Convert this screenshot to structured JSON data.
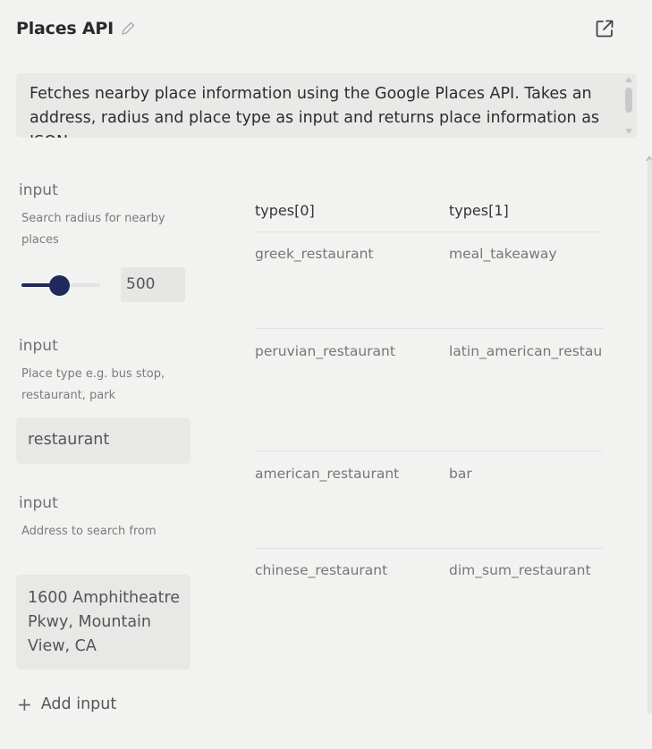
{
  "header": {
    "title": "Places API",
    "edit_icon": "pencil-icon",
    "open_icon": "external-link-icon"
  },
  "description": "Fetches nearby place information using the Google Places API. Takes an address, radius and place type as input and returns place information as JSON",
  "inputs": [
    {
      "label": "input",
      "hint": "Search radius for nearby places",
      "slider_value": 500,
      "slider_fraction": 0.49,
      "value": "500"
    },
    {
      "label": "input",
      "hint": "Place type e.g. bus stop, restaurant, park",
      "value": "restaurant"
    },
    {
      "label": "input",
      "hint": "Address to search from",
      "value": "1600 Amphitheatre Pkwy, Mountain View, CA"
    }
  ],
  "add_input_label": "Add input",
  "table": {
    "columns": [
      "types[0]",
      "types[1]"
    ],
    "rows": [
      [
        "greek_restaurant",
        "meal_takeaway"
      ],
      [
        "peruvian_restaurant",
        "latin_american_restaurant"
      ],
      [
        "american_restaurant",
        "bar"
      ],
      [
        "chinese_restaurant",
        "dim_sum_restaurant"
      ]
    ]
  },
  "colors": {
    "accent": "#21295c",
    "background": "#f2f2f1",
    "field": "#e8e8e7"
  }
}
